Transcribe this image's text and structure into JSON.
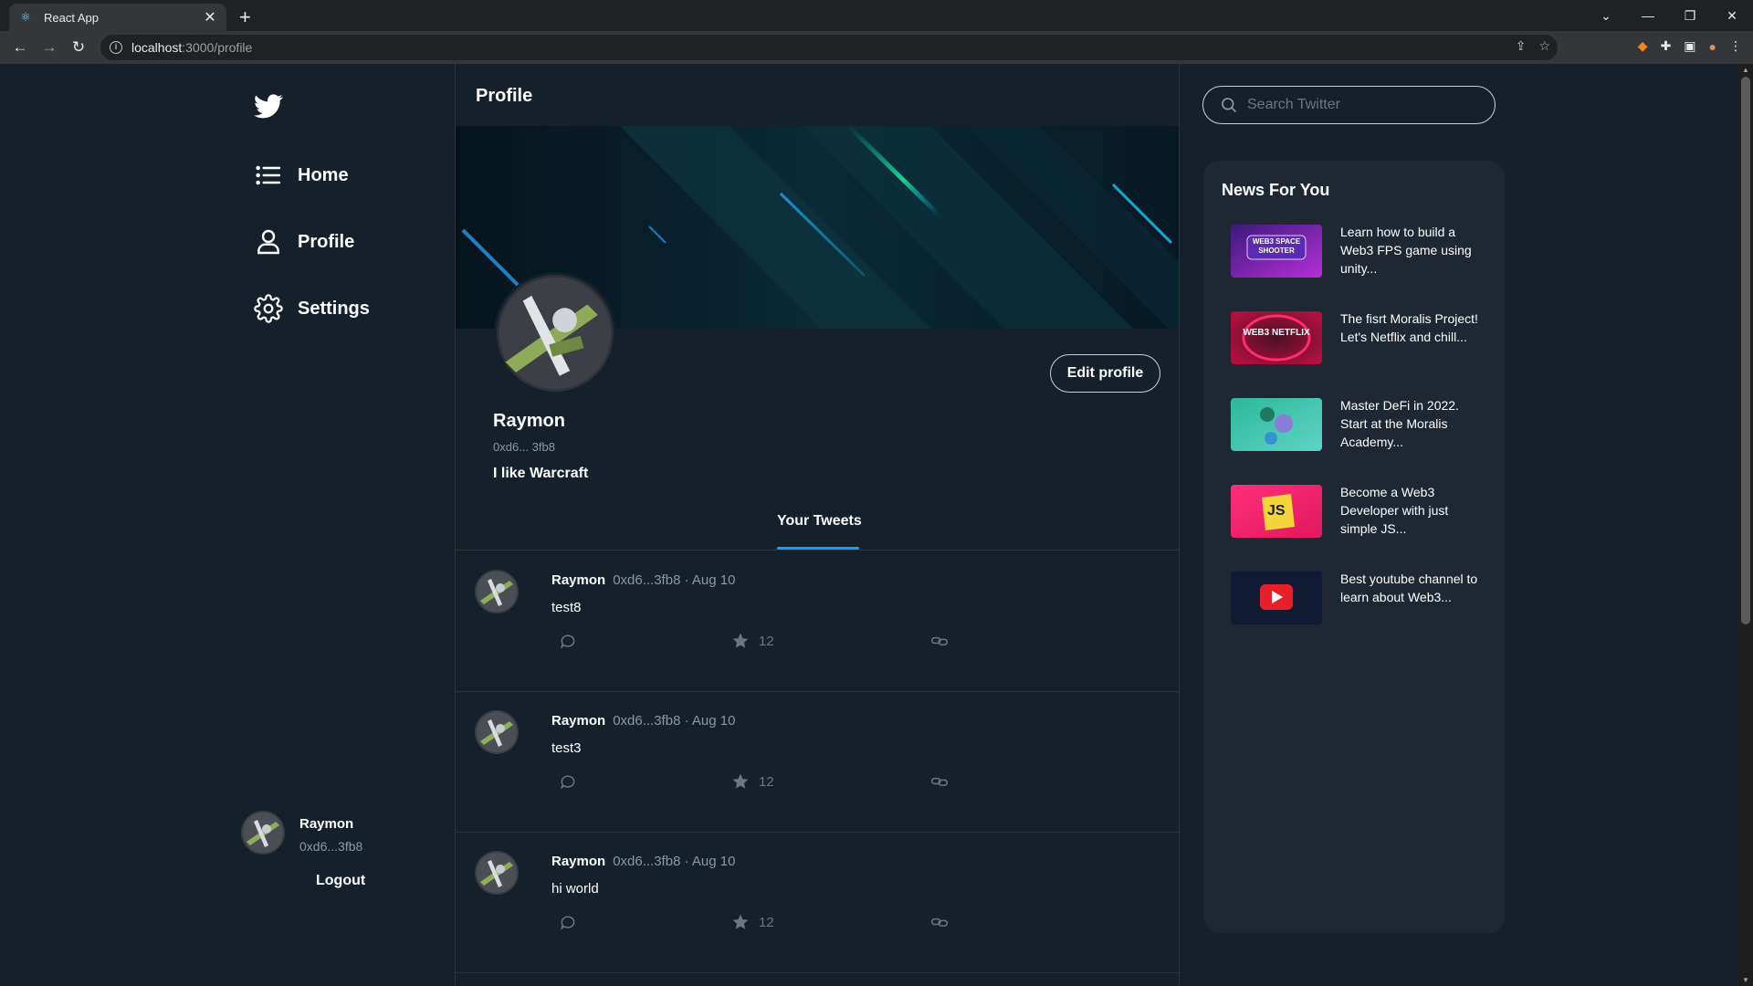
{
  "browser": {
    "tab_title": "React App",
    "url_host": "localhost",
    "url_rest": ":3000/profile"
  },
  "sidebar": {
    "nav": [
      {
        "label": "Home",
        "icon": "list-icon"
      },
      {
        "label": "Profile",
        "icon": "user-icon"
      },
      {
        "label": "Settings",
        "icon": "gear-icon"
      }
    ],
    "user": {
      "name": "Raymon",
      "handle": "0xd6...3fb8"
    },
    "logout_label": "Logout"
  },
  "main": {
    "title": "Profile",
    "profile": {
      "name": "Raymon",
      "handle": "0xd6... 3fb8",
      "bio": "I like Warcraft",
      "edit_label": "Edit profile"
    },
    "tab_label": "Your Tweets",
    "tweets": [
      {
        "name": "Raymon",
        "meta": "0xd6...3fb8 · Aug 10",
        "text": "test8",
        "likes": "12"
      },
      {
        "name": "Raymon",
        "meta": "0xd6...3fb8 · Aug 10",
        "text": "test3",
        "likes": "12"
      },
      {
        "name": "Raymon",
        "meta": "0xd6...3fb8 · Aug 10",
        "text": "hi world",
        "likes": "12"
      }
    ]
  },
  "right": {
    "search_placeholder": "Search Twitter",
    "news_title": "News For You",
    "news": [
      {
        "text": "Learn how to build a Web3 FPS game using unity...",
        "thumb_label": "WEB3 SPACE SHOOTER"
      },
      {
        "text": "The fisrt Moralis Project! Let's Netflix and chill...",
        "thumb_label": "WEB3 NETFLIX"
      },
      {
        "text": "Master DeFi in 2022. Start at the Moralis Academy...",
        "thumb_label": ""
      },
      {
        "text": "Become a Web3 Developer with just simple JS...",
        "thumb_label": "JS"
      },
      {
        "text": "Best youtube channel to learn about Web3...",
        "thumb_label": ""
      }
    ]
  },
  "colors": {
    "accent": "#1d9bf0",
    "background": "#15202b",
    "panel": "#1e2732"
  }
}
